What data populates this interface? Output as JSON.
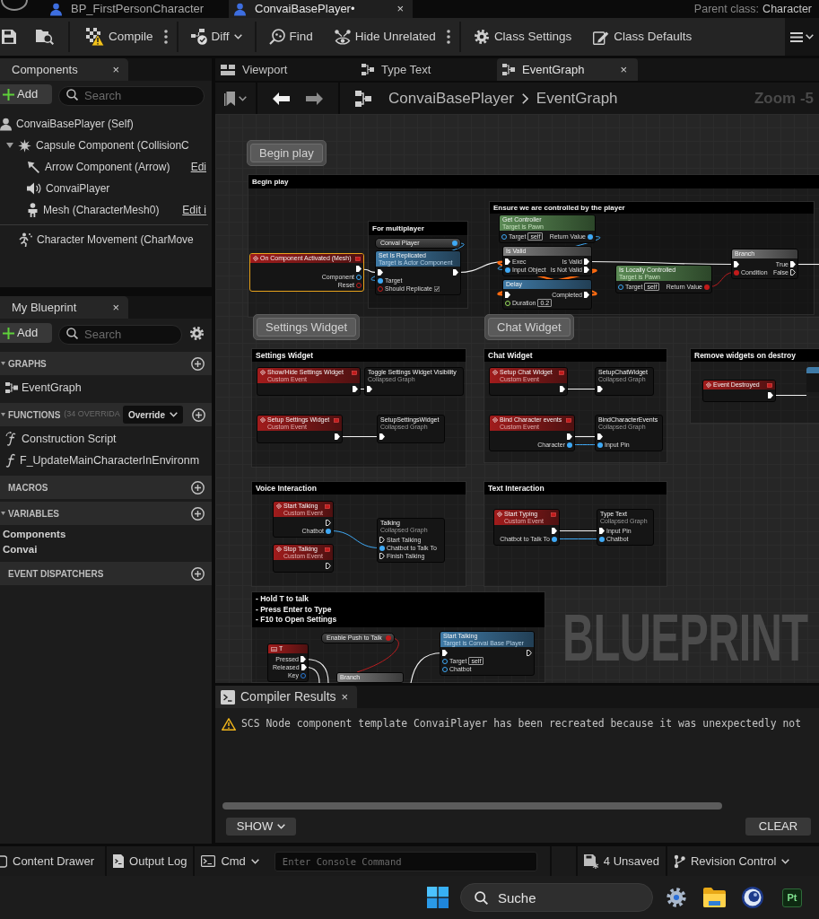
{
  "title_bar": {
    "tabs": [
      {
        "label": "BP_FirstPersonCharacter",
        "selected": false
      },
      {
        "label": "ConvaiBasePlayer•",
        "selected": true,
        "close": "×"
      }
    ],
    "parent_class": {
      "label": "Parent class:",
      "value": "Character"
    }
  },
  "toolbar": {
    "buttons": [
      {
        "kind": "compile",
        "label": "Compile",
        "warning": true,
        "dropdown": false,
        "more": true
      },
      {
        "kind": "diff",
        "label": "Diff",
        "dropdown": true,
        "more": false
      },
      {
        "kind": "find",
        "label": "Find",
        "dropdown": false,
        "more": false
      },
      {
        "kind": "hide",
        "label": "Hide Unrelated",
        "dropdown": false,
        "more": true
      },
      {
        "kind": "class_settings",
        "label": "Class Settings",
        "dropdown": false,
        "more": false
      },
      {
        "kind": "class_defaults",
        "label": "Class Defaults",
        "dropdown": false,
        "more": false
      }
    ]
  },
  "components_panel": {
    "tab": {
      "label": "Components",
      "close": "×"
    },
    "add_button": "Add",
    "search": {
      "placeholder": "Search"
    },
    "tree": [
      {
        "kind": "self",
        "label": "ConvaiBasePlayer (Self)",
        "children": [
          {
            "kind": "capsule",
            "label": "Capsule Component (CollisionC",
            "expanded": true,
            "children": [
              {
                "kind": "arrow",
                "label": "Arrow Component (Arrow)",
                "link": "Edi"
              },
              {
                "kind": "audio",
                "label": "ConvaiPlayer"
              },
              {
                "kind": "mesh",
                "label": "Mesh (CharacterMesh0)",
                "link": "Edit i"
              }
            ]
          }
        ]
      }
    ],
    "other_components": [
      {
        "kind": "movement",
        "label": "Character Movement (CharMove"
      }
    ]
  },
  "my_blueprint": {
    "tab": {
      "label": "My Blueprint",
      "close": "×"
    },
    "add_button": "Add",
    "search": {
      "placeholder": "Search"
    },
    "sections": [
      {
        "title": "GRAPHS",
        "expanded": true,
        "items": [
          {
            "kind": "graph",
            "label": "EventGraph"
          }
        ]
      },
      {
        "title": "FUNCTIONS",
        "note": "(34 OVERRIDA",
        "override_button": "Override",
        "expanded": true,
        "items": [
          {
            "kind": "construction",
            "label": "Construction Script"
          },
          {
            "kind": "function",
            "label": "F_UpdateMainCharacterInEnvironm"
          }
        ]
      },
      {
        "title": "MACROS",
        "expanded": false
      },
      {
        "title": "VARIABLES",
        "expanded": true,
        "items": [
          {
            "kind": "category",
            "label": "Components"
          },
          {
            "kind": "category",
            "label": "Convai"
          }
        ]
      },
      {
        "title": "EVENT DISPATCHERS",
        "expanded": false
      }
    ]
  },
  "graph_panel": {
    "tabs": [
      {
        "kind": "viewport",
        "label": "Viewport",
        "selected": false
      },
      {
        "kind": "graph",
        "label": "Type Text",
        "selected": false
      },
      {
        "kind": "graph",
        "label": "EventGraph",
        "selected": true,
        "close": "×"
      }
    ],
    "breadcrumb": [
      "ConvaiBasePlayer",
      "EventGraph"
    ],
    "zoom": "Zoom -5",
    "graph": {
      "bubbles": [
        {
          "label": "Begin play"
        },
        {
          "label": "Settings Widget"
        },
        {
          "label": "Chat Widget"
        }
      ],
      "comments": [
        {
          "title": "Begin play"
        },
        {
          "title": "For multiplayer"
        },
        {
          "title": "Ensure we are controlled by the player"
        },
        {
          "title": "Settings Widget"
        },
        {
          "title": "Chat Widget"
        },
        {
          "title": "Remove widgets on destroy"
        },
        {
          "title": "Voice Interaction"
        },
        {
          "title": "Text Interaction"
        },
        {
          "title": "- Hold T to talk\n- Press Enter to Type\n- F10 to Open Settings"
        }
      ],
      "nodes": [
        {
          "kind": "event",
          "title": "On Component Activated (Mesh)",
          "selected": true,
          "outputs": [
            {
              "kind": "exec",
              "linked": true
            },
            {
              "kind": "object",
              "label": "Component",
              "linked": false
            },
            {
              "kind": "bool",
              "label": "Reset",
              "linked": false
            }
          ]
        },
        {
          "kind": "getter",
          "title": "Convai Player",
          "selected": false,
          "outputs": [
            {
              "kind": "object",
              "linked": true
            }
          ]
        },
        {
          "kind": "function",
          "title": "Set Is Replicated",
          "subtitle": "Target is Actor Component",
          "selected": false,
          "inputs": [
            {
              "kind": "exec",
              "linked": true
            },
            {
              "kind": "object",
              "label": "Target",
              "linked": true
            },
            {
              "kind": "bool",
              "label": "Should Replicate",
              "linked": false,
              "checked": true
            }
          ],
          "outputs": [
            {
              "kind": "exec",
              "linked": true
            }
          ]
        },
        {
          "kind": "pure",
          "title": "Get Controller",
          "subtitle": "Target is Pawn",
          "selected": false,
          "inputs": [
            {
              "kind": "object",
              "label": "Target",
              "value": "self",
              "linked": false
            }
          ],
          "outputs": [
            {
              "kind": "object",
              "label": "Return Value",
              "linked": true
            }
          ]
        },
        {
          "kind": "macro",
          "title": "Is Valid",
          "selected": false,
          "inputs": [
            {
              "kind": "exec",
              "label": "Exec",
              "linked": true
            },
            {
              "kind": "object",
              "label": "Input Object",
              "linked": true
            }
          ],
          "outputs": [
            {
              "kind": "exec",
              "label": "Is Valid",
              "linked": true
            },
            {
              "kind": "exec",
              "label": "Is Not Valid",
              "linked": true
            }
          ]
        },
        {
          "kind": "function",
          "title": "Delay",
          "selected": false,
          "inputs": [
            {
              "kind": "exec",
              "linked": true
            },
            {
              "kind": "float",
              "label": "Duration",
              "value": "0.2",
              "linked": false
            }
          ],
          "outputs": [
            {
              "kind": "exec",
              "label": "Completed",
              "linked": true
            }
          ]
        },
        {
          "kind": "pure",
          "title": "Is Locally Controlled",
          "subtitle": "Target is Pawn",
          "selected": false,
          "inputs": [
            {
              "kind": "object",
              "label": "Target",
              "value": "self",
              "linked": false
            }
          ],
          "outputs": [
            {
              "kind": "bool",
              "label": "Return Value",
              "linked": true
            }
          ]
        },
        {
          "kind": "macro",
          "title": "Branch",
          "selected": false,
          "inputs": [
            {
              "kind": "exec",
              "linked": true
            },
            {
              "kind": "bool",
              "label": "Condition",
              "linked": true
            }
          ],
          "outputs": [
            {
              "kind": "exec",
              "label": "True",
              "linked": true
            },
            {
              "kind": "exec",
              "label": "False",
              "linked": false
            }
          ]
        },
        {
          "kind": "event",
          "title": "Show/Hide Settings Widget",
          "subtitle": "Custom Event",
          "selected": false,
          "outputs": [
            {
              "kind": "exec",
              "linked": true
            }
          ]
        },
        {
          "kind": "collapsed",
          "title": "Toggle Settings Widget Visibility",
          "subtitle": "Collapsed Graph",
          "selected": false,
          "inputs": [
            {
              "kind": "exec",
              "linked": true
            }
          ]
        },
        {
          "kind": "event",
          "title": "Setup Settings Widget",
          "subtitle": "Custom Event",
          "selected": false,
          "outputs": [
            {
              "kind": "exec",
              "linked": true
            }
          ]
        },
        {
          "kind": "collapsed",
          "title": "SetupSettingsWidget",
          "subtitle": "Collapsed Graph",
          "selected": false,
          "inputs": [
            {
              "kind": "exec",
              "linked": true
            }
          ]
        },
        {
          "kind": "event",
          "title": "Setup Chat Widget",
          "subtitle": "Custom Event",
          "selected": false,
          "outputs": [
            {
              "kind": "exec",
              "linked": true
            }
          ]
        },
        {
          "kind": "collapsed",
          "title": "SetupChatWidget",
          "subtitle": "Collapsed Graph",
          "selected": false,
          "inputs": [
            {
              "kind": "exec",
              "linked": true
            }
          ]
        },
        {
          "kind": "event",
          "title": "Bind Character events",
          "subtitle": "Custom Event",
          "selected": false,
          "outputs": [
            {
              "kind": "exec",
              "linked": true
            },
            {
              "kind": "object",
              "label": "Character",
              "linked": true
            }
          ]
        },
        {
          "kind": "collapsed",
          "title": "BindCharacterEvents",
          "subtitle": "Collapsed Graph",
          "selected": false,
          "inputs": [
            {
              "kind": "exec",
              "linked": true
            },
            {
              "kind": "object",
              "label": "Input Pin",
              "linked": true
            }
          ]
        },
        {
          "kind": "event",
          "title": "Event Destroyed",
          "selected": false,
          "outputs": [
            {
              "kind": "exec",
              "linked": true
            }
          ]
        },
        {
          "kind": "event",
          "title": "Start Talking",
          "subtitle": "Custom Event",
          "selected": false,
          "outputs": [
            {
              "kind": "exec",
              "linked": false
            },
            {
              "kind": "object",
              "label": "Chatbot",
              "linked": true
            }
          ]
        },
        {
          "kind": "event",
          "title": "Stop Talking",
          "subtitle": "Custom Event",
          "selected": false,
          "outputs": [
            {
              "kind": "exec",
              "linked": false
            }
          ]
        },
        {
          "kind": "collapsed",
          "title": "Talking",
          "subtitle": "Collapsed Graph",
          "selected": false,
          "inputs": [
            {
              "kind": "exec",
              "label": "Start Talking",
              "linked": false
            },
            {
              "kind": "object",
              "label": "Chatbot to Talk To",
              "linked": true
            },
            {
              "kind": "exec",
              "label": "Finish Talking",
              "linked": false
            }
          ]
        },
        {
          "kind": "event",
          "title": "Start Typing",
          "subtitle": "Custom Event",
          "selected": false,
          "outputs": [
            {
              "kind": "exec",
              "linked": true
            },
            {
              "kind": "object",
              "label": "Chatbot to Talk To",
              "linked": true
            }
          ]
        },
        {
          "kind": "collapsed",
          "title": "Type Text",
          "subtitle": "Collapsed Graph",
          "selected": false,
          "inputs": [
            {
              "kind": "exec",
              "label": "Input Pin",
              "linked": true
            },
            {
              "kind": "object",
              "label": "Chatbot",
              "linked": true
            }
          ]
        },
        {
          "kind": "key",
          "title": "T",
          "selected": false,
          "outputs": [
            {
              "kind": "exec",
              "label": "Pressed",
              "linked": true
            },
            {
              "kind": "exec",
              "label": "Released",
              "linked": true
            },
            {
              "kind": "struct",
              "label": "Key",
              "linked": false
            }
          ]
        },
        {
          "kind": "getter",
          "title": "Enable Push to Talk",
          "selected": false,
          "outputs": [
            {
              "kind": "bool",
              "linked": true
            }
          ]
        },
        {
          "kind": "macro",
          "title": "Branch",
          "selected": false
        },
        {
          "kind": "function",
          "title": "Start Talking",
          "subtitle": "Target is Convai Base Player",
          "selected": false,
          "inputs": [
            {
              "kind": "exec",
              "linked": true
            },
            {
              "kind": "object",
              "label": "Target",
              "value": "self",
              "linked": false
            },
            {
              "kind": "object",
              "label": "Chatbot",
              "linked": false
            }
          ],
          "outputs": [
            {
              "kind": "exec",
              "linked": false
            }
          ]
        }
      ],
      "corner_label": "BLUEPRINT"
    }
  },
  "compiler_results": {
    "tab": {
      "label": "Compiler Results",
      "close": "×"
    },
    "messages": [
      {
        "warning": true,
        "text": "SCS Node component template ConvaiPlayer has been recreated because it was unexpectedly not"
      }
    ],
    "show_button": "SHOW",
    "clear_button": "CLEAR"
  },
  "status_bar": {
    "items": [
      {
        "kind": "content_drawer",
        "label": "Content Drawer",
        "dropdown": false
      },
      {
        "kind": "output_log",
        "label": "Output Log",
        "dropdown": false
      },
      {
        "kind": "cmd",
        "label": "Cmd",
        "dropdown": true
      }
    ],
    "console": {
      "placeholder": "Enter Console Command"
    },
    "right_items": [
      {
        "kind": "unsaved",
        "label": "4 Unsaved",
        "dropdown": false
      },
      {
        "kind": "revision",
        "label": "Revision Control",
        "dropdown": true
      }
    ]
  },
  "taskbar": {
    "apps": [
      {
        "kind": "start"
      },
      {
        "kind": "search",
        "placeholder": "Suche"
      },
      {
        "kind": "settings"
      },
      {
        "kind": "explorer"
      },
      {
        "kind": "sphere"
      },
      {
        "kind": "painter",
        "label": "Pt"
      }
    ]
  }
}
